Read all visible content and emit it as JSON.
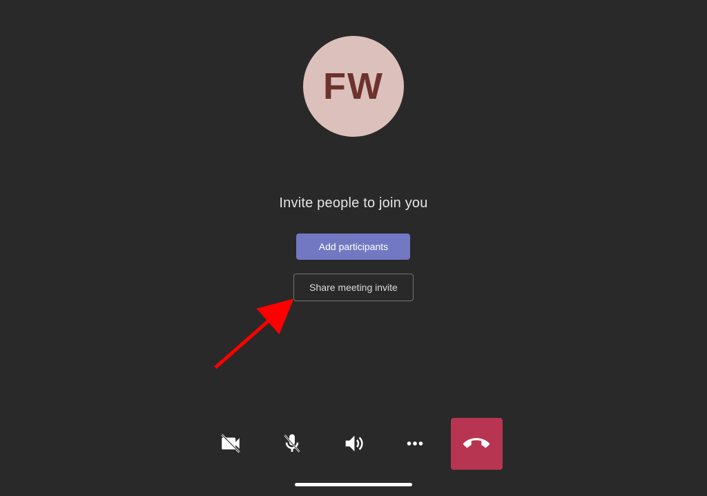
{
  "avatar": {
    "initials": "FW"
  },
  "heading": "Invite people to join you",
  "buttons": {
    "add_participants": "Add participants",
    "share_invite": "Share meeting invite"
  },
  "controls": {
    "camera": "camera-off",
    "mic": "mic-off",
    "speaker": "speaker",
    "more": "more",
    "end": "end-call"
  }
}
